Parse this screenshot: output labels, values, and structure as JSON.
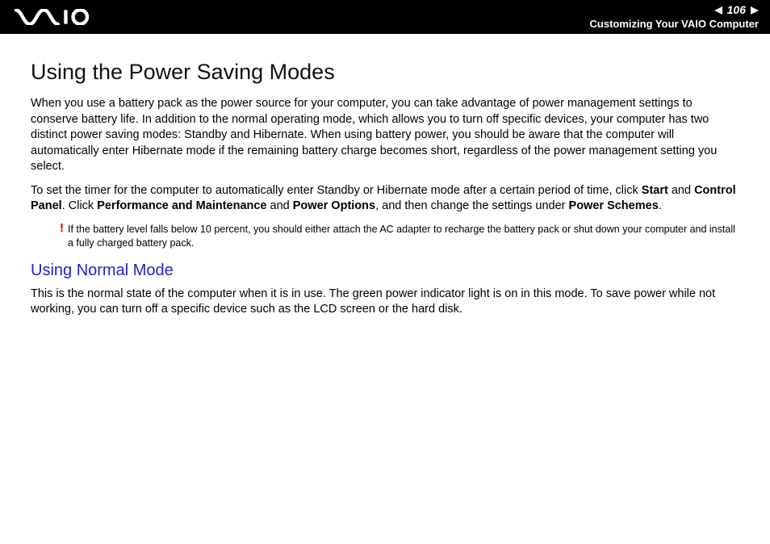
{
  "header": {
    "page_number": "106",
    "section": "Customizing Your VAIO Computer"
  },
  "main": {
    "title": "Using the Power Saving Modes",
    "p1": "When you use a battery pack as the power source for your computer, you can take advantage of power management settings to conserve battery life. In addition to the normal operating mode, which allows you to turn off specific devices, your computer has two distinct power saving modes: Standby and Hibernate. When using battery power, you should be aware that the computer will automatically enter Hibernate mode if the remaining battery charge becomes short, regardless of the power management setting you select.",
    "p2_pre": "To set the timer for the computer to automatically enter Standby or Hibernate mode after a certain period of time, click ",
    "p2_b1": "Start",
    "p2_mid1": " and ",
    "p2_b2": "Control Panel",
    "p2_mid2": ". Click ",
    "p2_b3": "Performance and Maintenance",
    "p2_mid3": " and ",
    "p2_b4": "Power Options",
    "p2_mid4": ", and then change the settings under ",
    "p2_b5": "Power Schemes",
    "p2_end": ".",
    "note_icon": "!",
    "note_text": "If the battery level falls below 10 percent, you should either attach the AC adapter to recharge the battery pack or shut down your computer and install a fully charged battery pack.",
    "subhead": "Using Normal Mode",
    "p3": "This is the normal state of the computer when it is in use. The green power indicator light is on in this mode. To save power while not working, you can turn off a specific device such as the LCD screen or the hard disk."
  }
}
